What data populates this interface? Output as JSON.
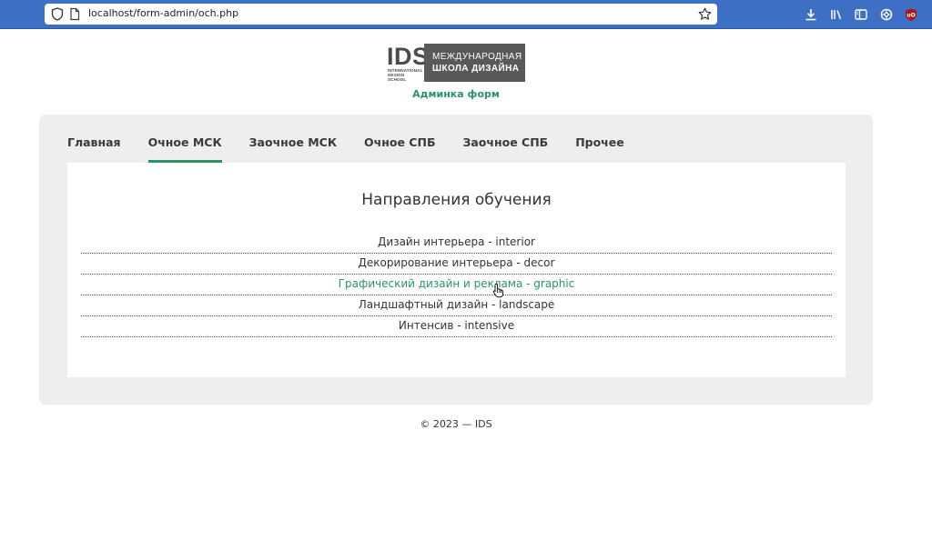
{
  "browser": {
    "url": "localhost/form-admin/och.php",
    "accent": "#3d6fc4"
  },
  "logo": {
    "brand": "IDS",
    "sub_line1": "INTERNATIONAL",
    "sub_line2": "DESIGN SCHOOL",
    "box_line1": "МЕЖДУНАРОДНАЯ",
    "box_line2": "ШКОЛА ДИЗАЙНА"
  },
  "header": {
    "subtitle": "Админка форм"
  },
  "nav": {
    "tabs": [
      {
        "label": "Главная"
      },
      {
        "label": "Очное МСК"
      },
      {
        "label": "Заочное МСК"
      },
      {
        "label": "Очное СПБ"
      },
      {
        "label": "Заочное СПБ"
      },
      {
        "label": "Прочее"
      }
    ],
    "active_index": 1
  },
  "main": {
    "title": "Направления обучения",
    "items": [
      {
        "label": "Дизайн интерьера - interior"
      },
      {
        "label": "Декорирование интерьера - decor"
      },
      {
        "label": "Графический дизайн и реклама - graphic"
      },
      {
        "label": "Ландшафтный дизайн - landscape"
      },
      {
        "label": "Интенсив - intensive"
      }
    ],
    "hovered_index": 2
  },
  "footer": {
    "text": "© 2023 — IDS"
  },
  "colors": {
    "brand_green": "#2a9468",
    "card_bg": "#eeeeee",
    "logo_gray": "#595959"
  },
  "icons": {
    "toolbar": [
      "download-icon",
      "library-icon",
      "sidebar-icon",
      "extensions-icon",
      "ublock-icon"
    ]
  }
}
